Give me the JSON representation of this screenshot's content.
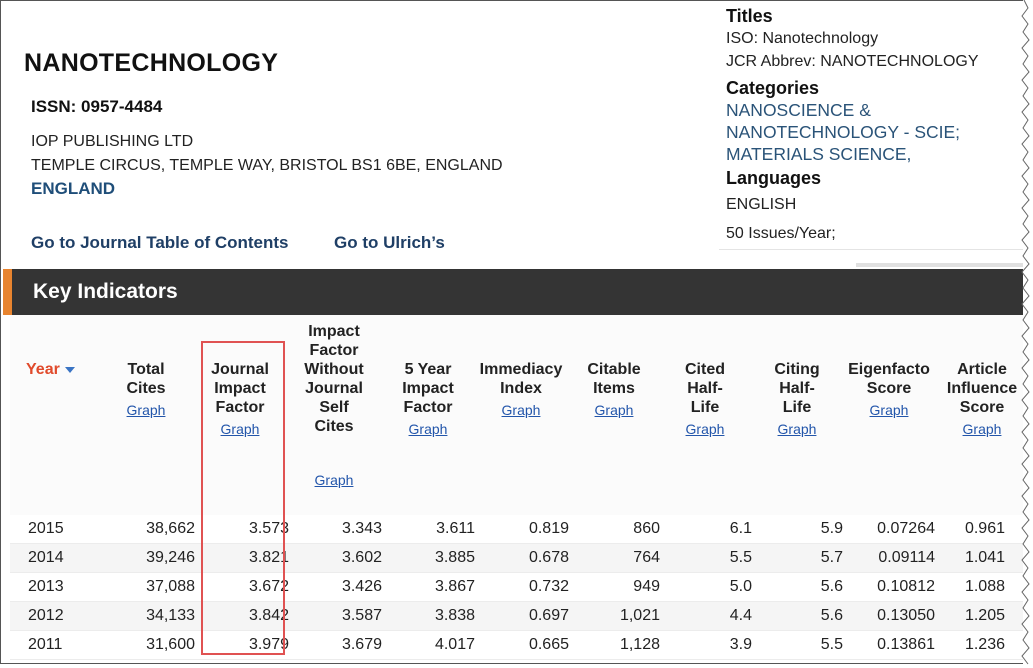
{
  "journal": {
    "title": "NANOTECHNOLOGY",
    "issn": "ISSN: 0957-4484",
    "publisher": "IOP PUBLISHING LTD",
    "address": "TEMPLE CIRCUS, TEMPLE WAY, BRISTOL BS1 6BE, ENGLAND",
    "country": "ENGLAND"
  },
  "links": {
    "toc": "Go to Journal Table of Contents",
    "ulrich": "Go to Ulrich’s"
  },
  "sidebar": {
    "titles_heading": "Titles",
    "iso": "ISO: Nanotechnology",
    "jcr_abbrev": "JCR Abbrev: NANOTECHNOLOGY",
    "categories_heading": "Categories",
    "category_1a": "NANOSCIENCE &",
    "category_1b": "NANOTECHNOLOGY - SCIE;",
    "category_2": "MATERIALS SCIENCE,",
    "languages_heading": "Languages",
    "language": "ENGLISH",
    "issues": "50 Issues/Year;"
  },
  "key_indicators": {
    "title": "Key Indicators",
    "graph_label": "Graph",
    "columns": [
      {
        "label": "Year"
      },
      {
        "label": "Total\nCites"
      },
      {
        "label": "Journal\nImpact\nFactor"
      },
      {
        "label": "Impact\nFactor\nWithout\nJournal\nSelf\nCites"
      },
      {
        "label": "5 Year\nImpact\nFactor"
      },
      {
        "label": "Immediacy\nIndex"
      },
      {
        "label": "Citable\nItems"
      },
      {
        "label": "Cited\nHalf-\nLife"
      },
      {
        "label": "Citing\nHalf-\nLife"
      },
      {
        "label": "Eigenfacto\nScore"
      },
      {
        "label": "Article\nInfluence\nScore"
      }
    ],
    "rows": [
      [
        "2015",
        "38,662",
        "3.573",
        "3.343",
        "3.611",
        "0.819",
        "860",
        "6.1",
        "5.9",
        "0.07264",
        "0.961"
      ],
      [
        "2014",
        "39,246",
        "3.821",
        "3.602",
        "3.885",
        "0.678",
        "764",
        "5.5",
        "5.7",
        "0.09114",
        "1.041"
      ],
      [
        "2013",
        "37,088",
        "3.672",
        "3.426",
        "3.867",
        "0.732",
        "949",
        "5.0",
        "5.6",
        "0.10812",
        "1.088"
      ],
      [
        "2012",
        "34,133",
        "3.842",
        "3.587",
        "3.838",
        "0.697",
        "1,021",
        "4.4",
        "5.6",
        "0.13050",
        "1.205"
      ],
      [
        "2011",
        "31,600",
        "3.979",
        "3.679",
        "4.017",
        "0.665",
        "1,128",
        "3.9",
        "5.5",
        "0.13861",
        "1.236"
      ]
    ]
  }
}
